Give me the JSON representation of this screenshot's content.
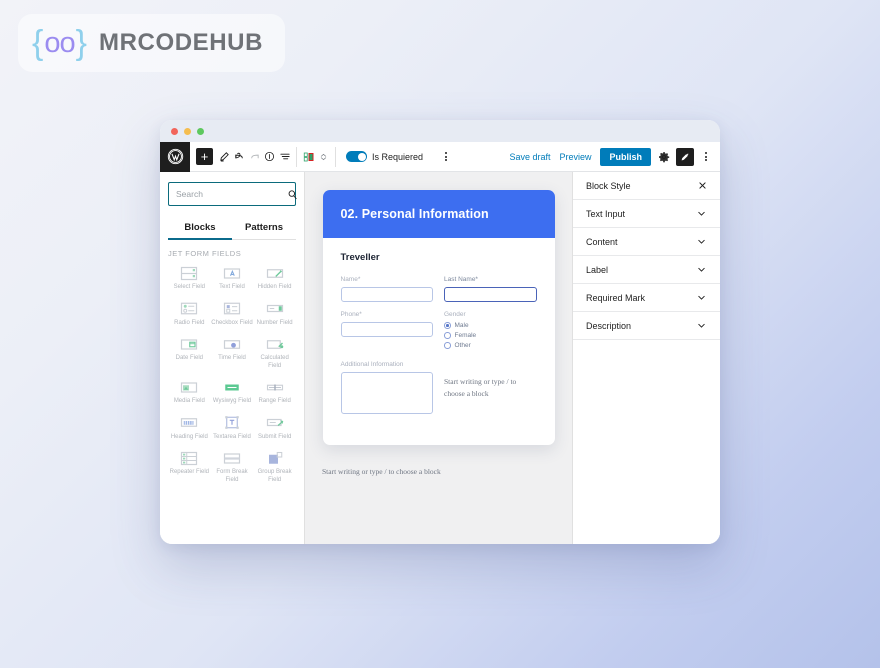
{
  "brand": {
    "brace_open": "{",
    "circles": "oo",
    "brace_close": "}",
    "name": "MRCODEHUB",
    "brace_color": "#8fd0ec",
    "circle_color": "#9b8cf0",
    "text_color": "#6f7277"
  },
  "window": {
    "dots": [
      "red",
      "yellow",
      "green"
    ]
  },
  "toolbar": {
    "wp_logo": "wordpress-icon",
    "add_block_label": "+",
    "icons": [
      "tools-pencil-icon",
      "undo-icon",
      "redo-icon",
      "info-icon",
      "list-view-icon",
      "block-type-icon",
      "selector-chevrons-icon"
    ],
    "toggle": {
      "label": "Is Requiered",
      "enabled": true,
      "color": "#007cba"
    },
    "save_draft_label": "Save draft",
    "preview_label": "Preview",
    "publish_label": "Publish",
    "publish_color": "#007cba",
    "settings_icon": "gear-icon",
    "styles_icon": "brush-icon",
    "more_icon": "kebab-menu-icon"
  },
  "inserter": {
    "search": {
      "placeholder": "Search",
      "value": ""
    },
    "tabs": [
      {
        "label": "Blocks",
        "active": true
      },
      {
        "label": "Patterns",
        "active": false
      }
    ],
    "section_title": "JET FORM FIELDS",
    "blocks": [
      {
        "label": "Select Field",
        "icon": "select-field-icon"
      },
      {
        "label": "Text Field",
        "icon": "text-field-icon"
      },
      {
        "label": "Hidden Field",
        "icon": "hidden-field-icon"
      },
      {
        "label": "Radio Field",
        "icon": "radio-field-icon"
      },
      {
        "label": "Checkbox Field",
        "icon": "checkbox-field-icon"
      },
      {
        "label": "Number Field",
        "icon": "number-field-icon"
      },
      {
        "label": "Date Field",
        "icon": "date-field-icon"
      },
      {
        "label": "Time Field",
        "icon": "time-field-icon"
      },
      {
        "label": "Calculated Field",
        "icon": "calculated-field-icon"
      },
      {
        "label": "Media Field",
        "icon": "media-field-icon"
      },
      {
        "label": "Wysiwyg Field",
        "icon": "wysiwyg-field-icon"
      },
      {
        "label": "Range Field",
        "icon": "range-field-icon"
      },
      {
        "label": "Heading Field",
        "icon": "heading-field-icon"
      },
      {
        "label": "Textarea Field",
        "icon": "textarea-field-icon"
      },
      {
        "label": "Submit Field",
        "icon": "submit-field-icon"
      },
      {
        "label": "Repeater Field",
        "icon": "repeater-field-icon"
      },
      {
        "label": "Form Break Field",
        "icon": "form-break-field-icon"
      },
      {
        "label": "Group Break Field",
        "icon": "group-break-field-icon"
      }
    ]
  },
  "form": {
    "header_title": "02. Personal Information",
    "header_color": "#3d6ef0",
    "section_heading": "Treveller",
    "fields": {
      "name": {
        "label": "Name*",
        "value": "",
        "focused": false
      },
      "last_name": {
        "label": "Last Name*",
        "value": "",
        "focused": true
      },
      "phone": {
        "label": "Phone*",
        "value": "",
        "focused": false
      },
      "additional": {
        "label": "Additional Information",
        "value": "",
        "focused": false
      }
    },
    "gender": {
      "label": "Gender",
      "options": [
        {
          "label": "Male",
          "selected": true
        },
        {
          "label": "Female",
          "selected": false
        },
        {
          "label": "Other",
          "selected": false
        }
      ]
    },
    "block_hint": "Start writing or type / to choose a block"
  },
  "canvas": {
    "bottom_hint": "Start writing or type / to choose a block"
  },
  "settings": {
    "rows": [
      {
        "label": "Block Style",
        "control": "close-icon"
      },
      {
        "label": "Text Input",
        "control": "chevron-down-icon"
      },
      {
        "label": "Content",
        "control": "chevron-down-icon"
      },
      {
        "label": "Label",
        "control": "chevron-down-icon"
      },
      {
        "label": "Required Mark",
        "control": "chevron-down-icon"
      },
      {
        "label": "Description",
        "control": "chevron-down-icon"
      }
    ]
  }
}
